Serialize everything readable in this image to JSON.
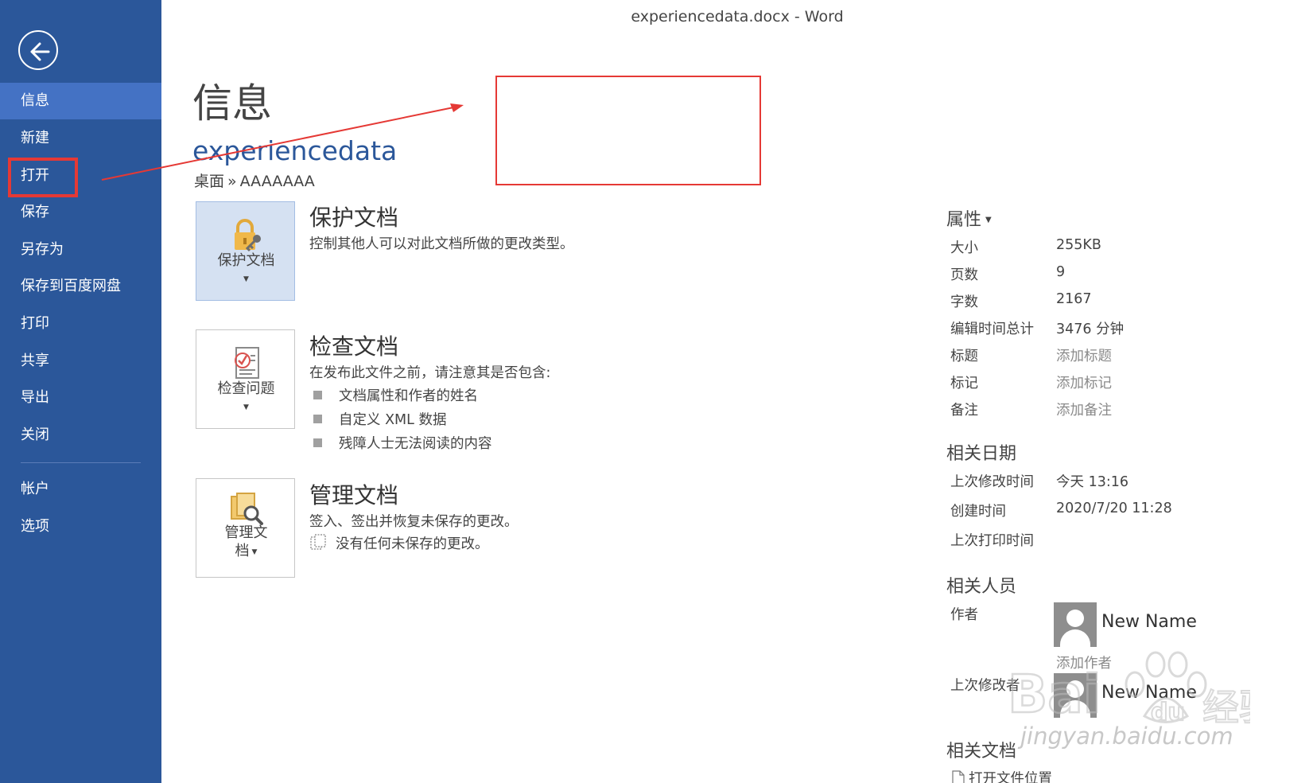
{
  "window": {
    "title": "experiencedata.docx - Word"
  },
  "colors": {
    "sidebar": "#2b579a",
    "sidebar_active": "#4472c4",
    "accent": "#2b579a",
    "annotation": "#e53935"
  },
  "sidebar": {
    "back_icon": "arrow-left-circle-icon",
    "items": [
      {
        "label": "信息",
        "active": true
      },
      {
        "label": "新建"
      },
      {
        "label": "打开",
        "highlighted": true
      },
      {
        "label": "保存"
      },
      {
        "label": "另存为"
      },
      {
        "label": "保存到百度网盘"
      },
      {
        "label": "打印"
      },
      {
        "label": "共享"
      },
      {
        "label": "导出"
      },
      {
        "label": "关闭"
      }
    ],
    "bottom_items": [
      {
        "label": "帐户"
      },
      {
        "label": "选项"
      }
    ]
  },
  "main": {
    "title": "信息",
    "doc_name": "experiencedata",
    "path": {
      "folder": "桌面",
      "separator": "»",
      "subfolder": "AAAAAAA"
    },
    "protect": {
      "button_label": "保护文档",
      "icon": "lock-key-icon",
      "title": "保护文档",
      "desc": "控制其他人可以对此文档所做的更改类型。"
    },
    "inspect": {
      "button_label": "检查问题",
      "icon": "checklist-icon",
      "title": "检查文档",
      "desc": "在发布此文件之前，请注意其是否包含:",
      "bullets": [
        "文档属性和作者的姓名",
        "自定义 XML 数据",
        "残障人士无法阅读的内容"
      ]
    },
    "manage": {
      "button_label_line1": "管理文",
      "button_label_line2": "档",
      "icon": "documents-search-icon",
      "title": "管理文档",
      "desc": "签入、签出并恢复未保存的更改。",
      "status": "没有任何未保存的更改。"
    }
  },
  "properties": {
    "title": "属性",
    "rows": [
      {
        "label": "大小",
        "value": "255KB"
      },
      {
        "label": "页数",
        "value": "9"
      },
      {
        "label": "字数",
        "value": "2167"
      },
      {
        "label": "编辑时间总计",
        "value": "3476 分钟"
      },
      {
        "label": "标题",
        "value": "添加标题"
      },
      {
        "label": "标记",
        "value": "添加标记"
      },
      {
        "label": "备注",
        "value": "添加备注"
      }
    ],
    "dates_title": "相关日期",
    "dates": [
      {
        "label": "上次修改时间",
        "value": "今天 13:16"
      },
      {
        "label": "创建时间",
        "value": "2020/7/20 11:28"
      },
      {
        "label": "上次打印时间",
        "value": ""
      }
    ],
    "people_title": "相关人员",
    "author_label": "作者",
    "author_name": "New Name",
    "add_author": "添加作者",
    "last_modified_by_label": "上次修改者",
    "last_modified_by_name": "New Name",
    "docs_title": "相关文档",
    "open_location": "打开文件位置"
  },
  "watermark": {
    "text": "jingyan.baidu.com"
  }
}
